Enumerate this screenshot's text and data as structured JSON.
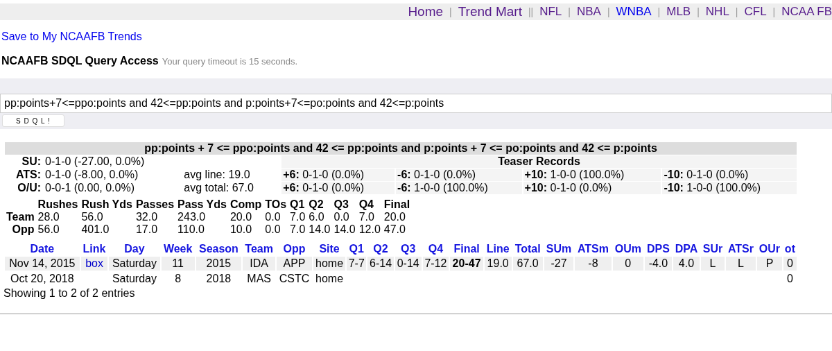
{
  "nav": {
    "items": [
      {
        "label": "Home",
        "visited": true,
        "sep": "|",
        "kind": "site"
      },
      {
        "label": "Trend Mart",
        "visited": true,
        "sep": "||",
        "kind": "site"
      },
      {
        "label": "NFL",
        "visited": true,
        "sep": "|",
        "kind": "league"
      },
      {
        "label": "NBA",
        "visited": true,
        "sep": "|",
        "kind": "league"
      },
      {
        "label": "WNBA",
        "visited": false,
        "sep": "|",
        "kind": "league"
      },
      {
        "label": "MLB",
        "visited": true,
        "sep": "|",
        "kind": "league"
      },
      {
        "label": "NHL",
        "visited": true,
        "sep": "|",
        "kind": "league"
      },
      {
        "label": "CFL",
        "visited": true,
        "sep": "|",
        "kind": "league"
      },
      {
        "label": "NCAA FB",
        "visited": true,
        "kind": "league"
      }
    ]
  },
  "save_link": "Save to My NCAAFB Trends",
  "heading": {
    "title": "NCAAFB SDQL Query Access",
    "note": "Your query timeout is 15 seconds."
  },
  "query": {
    "value": "pp:points+7<=ppo:points and 42<=pp:points and p:points+7<=po:points and 42<=p:points",
    "button": "S D Q L !"
  },
  "records": {
    "title": "pp:points + 7 <= ppo:points and 42 <= pp:points and p:points + 7 <= po:points and 42 <= p:points",
    "teaser_heading": "Teaser Records",
    "rows": [
      {
        "label": "SU:",
        "record": "0-1-0 (-27.00, 0.0%)"
      },
      {
        "label": "ATS:",
        "record": "0-1-0 (-8.00, 0.0%)",
        "avg": "avg line: 19.0",
        "teasers": [
          {
            "label": "+6:",
            "value": "0-1-0 (0.0%)"
          },
          {
            "label": "-6:",
            "value": "0-1-0 (0.0%)"
          },
          {
            "label": "+10:",
            "value": "1-0-0 (100.0%)"
          },
          {
            "label": "-10:",
            "value": "0-1-0 (0.0%)"
          }
        ]
      },
      {
        "label": "O/U:",
        "record": "0-0-1 (0.00, 0.0%)",
        "avg": "avg total: 67.0",
        "teasers": [
          {
            "label": "+6:",
            "value": "0-1-0 (0.0%)"
          },
          {
            "label": "-6:",
            "value": "1-0-0 (100.0%)"
          },
          {
            "label": "+10:",
            "value": "0-1-0 (0.0%)"
          },
          {
            "label": "-10:",
            "value": "1-0-0 (100.0%)"
          }
        ]
      }
    ]
  },
  "stats": {
    "columns": [
      "Rushes",
      "Rush Yds",
      "Passes",
      "Pass Yds",
      "Comp",
      "TOs",
      "Q1",
      "Q2",
      "Q3",
      "Q4",
      "Final"
    ],
    "rows": [
      {
        "label": "Team",
        "cells": [
          "28.0",
          "56.0",
          "32.0",
          "243.0",
          "20.0",
          "0.0",
          "7.0",
          "6.0",
          "0.0",
          "7.0",
          "20.0"
        ]
      },
      {
        "label": "Opp",
        "cells": [
          "56.0",
          "401.0",
          "17.0",
          "110.0",
          "10.0",
          "0.0",
          "7.0",
          "14.0",
          "14.0",
          "12.0",
          "47.0"
        ]
      }
    ]
  },
  "games": {
    "columns": [
      {
        "label": "Date",
        "kind": "text"
      },
      {
        "label": "Link",
        "kind": "link"
      },
      {
        "label": "Day",
        "kind": "text"
      },
      {
        "label": "Week",
        "kind": "text"
      },
      {
        "label": "Season",
        "kind": "text"
      },
      {
        "label": "Team",
        "kind": "text"
      },
      {
        "label": "Opp",
        "kind": "text"
      },
      {
        "label": "Site",
        "kind": "text"
      },
      {
        "label": "Q1",
        "kind": "text"
      },
      {
        "label": "Q2",
        "kind": "text"
      },
      {
        "label": "Q3",
        "kind": "text"
      },
      {
        "label": "Q4",
        "kind": "text"
      },
      {
        "label": "Final",
        "kind": "strong"
      },
      {
        "label": "Line",
        "kind": "text"
      },
      {
        "label": "Total",
        "kind": "text"
      },
      {
        "label": "SUm",
        "kind": "text"
      },
      {
        "label": "ATSm",
        "kind": "text"
      },
      {
        "label": "OUm",
        "kind": "text"
      },
      {
        "label": "DPS",
        "kind": "text"
      },
      {
        "label": "DPA",
        "kind": "text"
      },
      {
        "label": "SUr",
        "kind": "text"
      },
      {
        "label": "ATSr",
        "kind": "text"
      },
      {
        "label": "OUr",
        "kind": "text"
      },
      {
        "label": "ot",
        "kind": "text"
      }
    ],
    "rows": [
      {
        "cells": [
          "Nov 14, 2015",
          "box",
          "Saturday",
          "11",
          "2015",
          "IDA",
          "APP",
          "home",
          "7-7",
          "6-14",
          "0-14",
          "7-12",
          "20-47",
          "19.0",
          "67.0",
          "-27",
          "-8",
          "0",
          "-4.0",
          "4.0",
          "L",
          "L",
          "P",
          "0"
        ]
      },
      {
        "cells": [
          "Oct 20, 2018",
          null,
          "Saturday",
          "8",
          "2018",
          "MAS",
          "CSTC",
          "home",
          null,
          null,
          null,
          null,
          null,
          null,
          null,
          null,
          null,
          null,
          null,
          null,
          null,
          null,
          null,
          "0"
        ]
      }
    ],
    "info": "Showing 1 to 2 of 2 entries"
  }
}
